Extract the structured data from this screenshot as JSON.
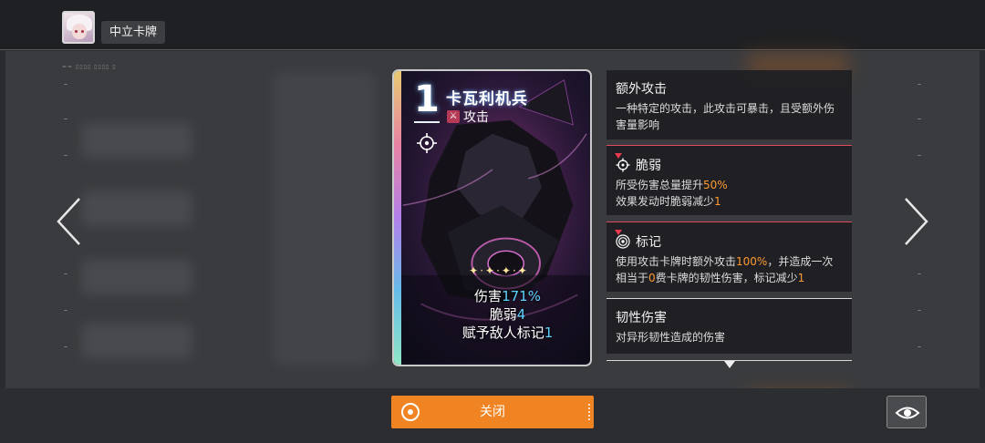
{
  "header": {
    "label": "中立卡牌",
    "tiny_caption": "== ▯▯▯▯ ▯▯▯▯ ▯"
  },
  "card": {
    "cost": "1",
    "name": "卡瓦利机兵",
    "type_label": "攻击",
    "sparkles": "✦·✦·✦·✦",
    "stats": {
      "damage_label": "伤害",
      "damage_value": "171%",
      "weak_label": "脆弱",
      "weak_value": "4",
      "mark_label": "赋予敌人标记",
      "mark_value": "1"
    },
    "accent_color": "#5cd2ff"
  },
  "info_panels": {
    "extra_attack": {
      "title": "额外攻击",
      "desc": "一种特定的攻击，此攻击可暴击，且受额外伤害量影响"
    },
    "fragile": {
      "title": "脆弱",
      "desc_1a": "所受伤害总量提升",
      "desc_1b": "50%",
      "desc_2a": "效果发动时脆弱减少",
      "desc_2b": "1",
      "icon": "crosshair-icon"
    },
    "mark": {
      "title": "标记",
      "desc_a": "使用攻击卡牌时额外攻击",
      "desc_b": "100%",
      "desc_c": "，并造成一次相当于",
      "desc_d": "0",
      "desc_e": "费卡牌的韧性伤害，标记减少",
      "desc_f": "1",
      "icon": "target-icon"
    },
    "toughness": {
      "title": "韧性伤害",
      "desc": "对异形韧性造成的伤害"
    },
    "highlight_color": "#ff9a2e"
  },
  "footer": {
    "close_label": "关闭",
    "eye_icon": "eye-icon",
    "close_color": "#f08423"
  },
  "nav": {
    "prev_icon": "chevron-left-icon",
    "next_icon": "chevron-right-icon"
  }
}
